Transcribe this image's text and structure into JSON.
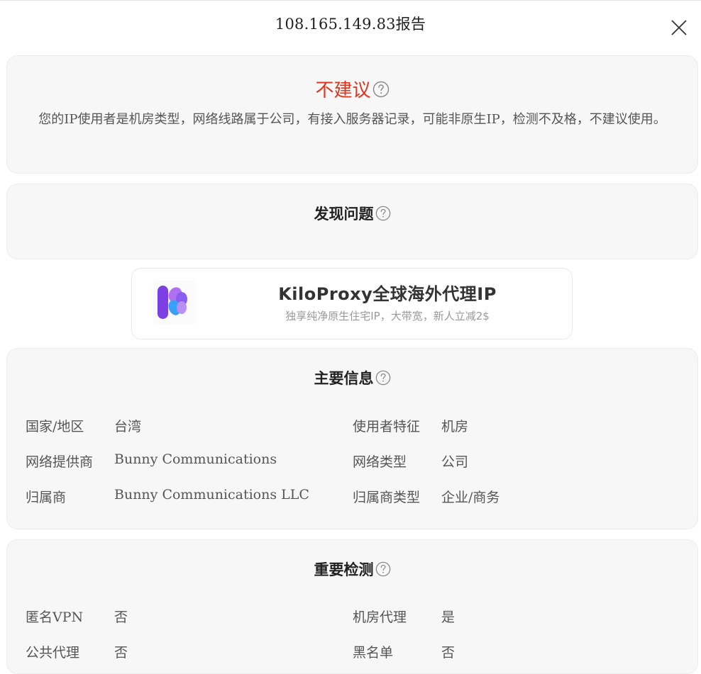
{
  "header": {
    "title": "108.165.149.83报告"
  },
  "verdict": {
    "title": "不建议",
    "description": "您的IP使用者是机房类型，网络线路属于公司，有接入服务器记录，可能非原生IP，检测不及格，不建议使用。"
  },
  "issues": {
    "heading": "发现问题"
  },
  "ad": {
    "title": "KiloProxy全球海外代理IP",
    "subtitle": "独享纯净原生住宅IP，大带宽，新人立减2$"
  },
  "main_info": {
    "heading": "主要信息",
    "rows": [
      {
        "label": "国家/地区",
        "value": "台湾"
      },
      {
        "label": "使用者特征",
        "value": "机房"
      },
      {
        "label": "网络提供商",
        "value": "Bunny Communications"
      },
      {
        "label": "网络类型",
        "value": "公司"
      },
      {
        "label": "归属商",
        "value": "Bunny Communications LLC"
      },
      {
        "label": "归属商类型",
        "value": "企业/商务"
      }
    ]
  },
  "checks": {
    "heading": "重要检测",
    "rows": [
      {
        "label": "匿名VPN",
        "value": "否"
      },
      {
        "label": "机房代理",
        "value": "是"
      },
      {
        "label": "公共代理",
        "value": "否"
      },
      {
        "label": "黑名单",
        "value": "否"
      }
    ]
  },
  "colors": {
    "verdict": "#e0341e",
    "card_bg": "#f7f7f7",
    "logo_purple": "#7b3fe4",
    "logo_blue": "#3aa0f5"
  }
}
